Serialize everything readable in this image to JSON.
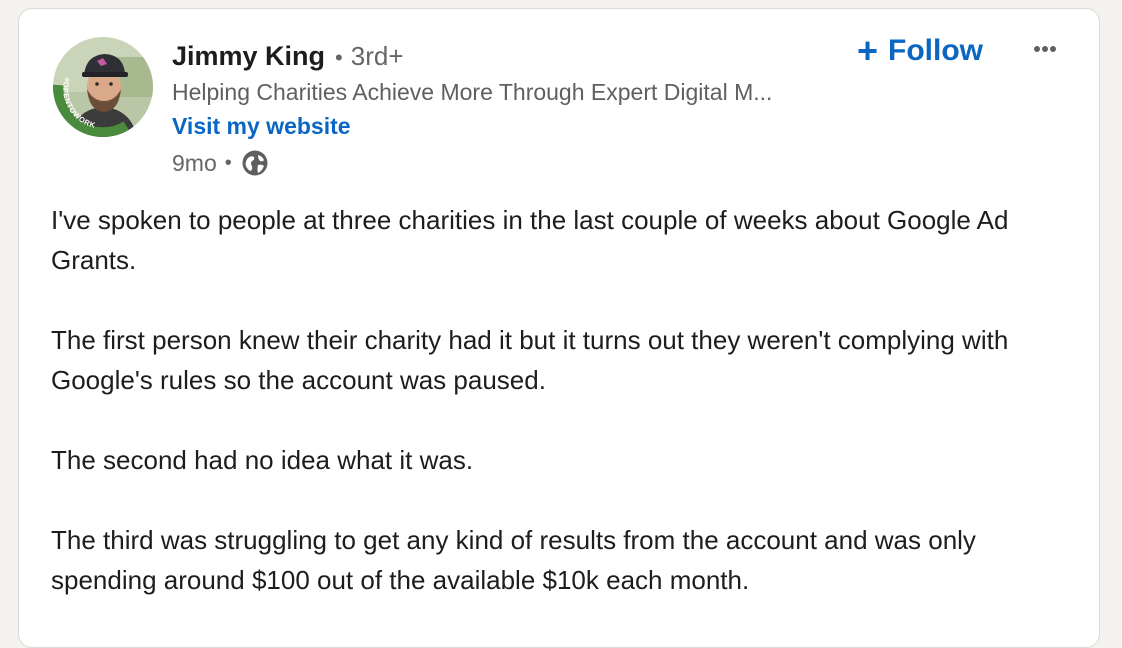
{
  "author": {
    "name": "Jimmy King",
    "separator": "•",
    "degree": "3rd+",
    "headline": "Helping Charities Achieve More Through Expert Digital M...",
    "website_label": "Visit my website",
    "avatar_badge_text": "#OPENTOWORK"
  },
  "meta": {
    "time": "9mo",
    "separator": "•",
    "visibility_icon": "globe-icon"
  },
  "actions": {
    "follow_label": "Follow",
    "follow_icon": "plus-icon",
    "more_icon": "ellipsis-icon"
  },
  "post": {
    "paragraphs": [
      "I've spoken to people at three charities in the last couple of weeks about Google Ad Grants.",
      "The first person knew their charity had it but it turns out they weren't complying with Google's rules so the account was paused.",
      "The second had no idea what it was.",
      "The third was struggling to get any kind of results from the account and was only spending around $100 out of the available $10k each month."
    ]
  },
  "colors": {
    "accent": "#0a66c2",
    "open_to_work_green": "#4a8a3c",
    "text_primary": "#1d1d1d",
    "text_secondary": "#666666"
  }
}
